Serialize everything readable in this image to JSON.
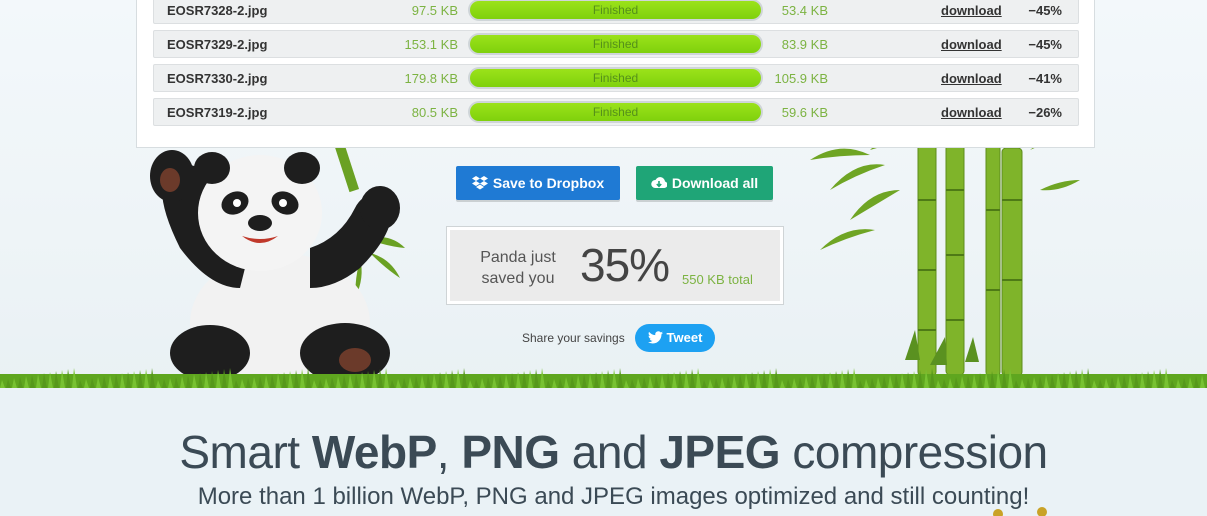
{
  "files": [
    {
      "name": "EOSR7328-2.jpg",
      "original_size": "97.5 KB",
      "status": "Finished",
      "new_size": "53.4 KB",
      "link": "download",
      "saving": "−45%",
      "progress": 1.0
    },
    {
      "name": "EOSR7329-2.jpg",
      "original_size": "153.1 KB",
      "status": "Finished",
      "new_size": "83.9 KB",
      "link": "download",
      "saving": "−45%",
      "progress": 1.0
    },
    {
      "name": "EOSR7330-2.jpg",
      "original_size": "179.8 KB",
      "status": "Finished",
      "new_size": "105.9 KB",
      "link": "download",
      "saving": "−41%",
      "progress": 1.0
    },
    {
      "name": "EOSR7319-2.jpg",
      "original_size": "80.5 KB",
      "status": "Finished",
      "new_size": "59.6 KB",
      "link": "download",
      "saving": "−26%",
      "progress": 1.0
    }
  ],
  "actions": {
    "dropbox_label": "Save to Dropbox",
    "download_all_label": "Download all",
    "dropbox_icon": "dropbox-icon",
    "download_icon": "cloud-download-icon"
  },
  "savings": {
    "label": "Panda just saved you",
    "percent": "35%",
    "total": "550 KB total"
  },
  "share": {
    "label": "Share your savings",
    "tweet_label": "Tweet",
    "tweet_icon": "twitter-bird-icon"
  },
  "hero": {
    "headline_parts": [
      "Smart ",
      "WebP",
      ", ",
      "PNG",
      " and ",
      "JPEG",
      " compression"
    ],
    "subheadline": "More than 1 billion WebP, PNG and JPEG images optimized and still counting!"
  },
  "colors": {
    "progress_fill": "#8ddb14",
    "size_text": "#7cb342",
    "dropbox_button": "#1f7ad4",
    "download_button": "#1fa577",
    "tweet_button": "#1da1f2"
  }
}
